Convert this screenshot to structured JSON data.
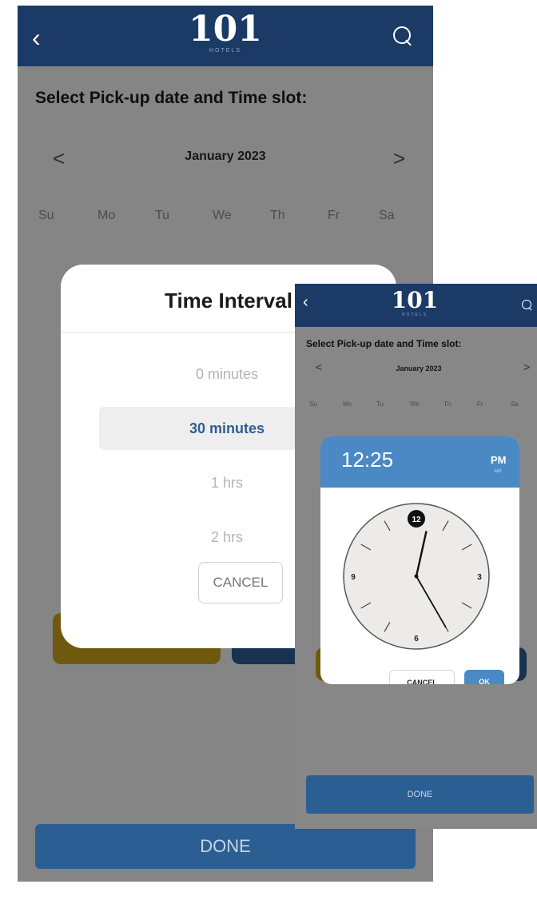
{
  "screen": {
    "header": {
      "logo": "101",
      "logo_sub": "HOTELS",
      "back_icon": "chevron-left-icon",
      "search_icon": "search-icon"
    },
    "title": "Select Pick-up date and Time slot:",
    "calendar": {
      "month": "January 2023",
      "prev": "<",
      "next": ">",
      "weekdays": [
        "Su",
        "Mo",
        "Tu",
        "We",
        "Th",
        "Fr",
        "Sa"
      ]
    },
    "done_label": "DONE"
  },
  "time_interval_dialog": {
    "title": "Time Interval",
    "options": [
      "0 minutes",
      "30 minutes",
      "1 hrs",
      "2 hrs"
    ],
    "selected": "30 minutes",
    "cancel_label": "CANCEL"
  },
  "time_picker_dialog": {
    "time": "12:25",
    "pm_label": "PM",
    "am_label": "AM",
    "numbers": {
      "twelve": "12",
      "three": "3",
      "six": "6",
      "nine": "9"
    },
    "hour": 12,
    "minute": 25,
    "cancel_label": "CANCEL",
    "ok_label": "OK"
  },
  "colors": {
    "header": "#1b3a66",
    "accent": "#4a89c4",
    "selected_text": "#2d5d91",
    "done": "#2b5e93",
    "yellow_button": "#c8a21d"
  }
}
